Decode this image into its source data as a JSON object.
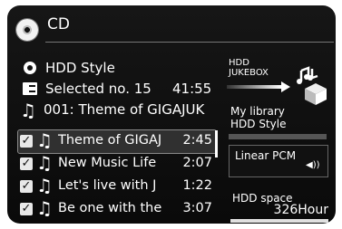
{
  "header": {
    "title": "CD"
  },
  "info": {
    "hdd_style": "HDD Style",
    "selected": "Selected no. 15",
    "selected_time": "41:55",
    "now_playing": "001:   Theme of GIGAJUK"
  },
  "tracks": [
    {
      "title": "Theme of GIGAJ",
      "time": "2:45",
      "checked": true,
      "selected": true
    },
    {
      "title": "New Music Life",
      "time": "2:07",
      "checked": true,
      "selected": false
    },
    {
      "title": "Let's live with J",
      "time": "1:22",
      "checked": true,
      "selected": false
    },
    {
      "title": "Be one with the",
      "time": "3:07",
      "checked": true,
      "selected": false
    }
  ],
  "right_panel": {
    "jukebox_line1": "HDD",
    "jukebox_line2": "JUKEBOX",
    "library_line1": "My library",
    "library_line2": "HDD Style",
    "format": "Linear PCM",
    "space_label": "HDD space",
    "space_value": "326Hour"
  },
  "icons": {
    "disc": "cd-disc-icon",
    "hdd": "hdd-style-icon",
    "list": "selected-list-icon",
    "note": "music-note-icon",
    "speaker": "speaker-icon"
  }
}
